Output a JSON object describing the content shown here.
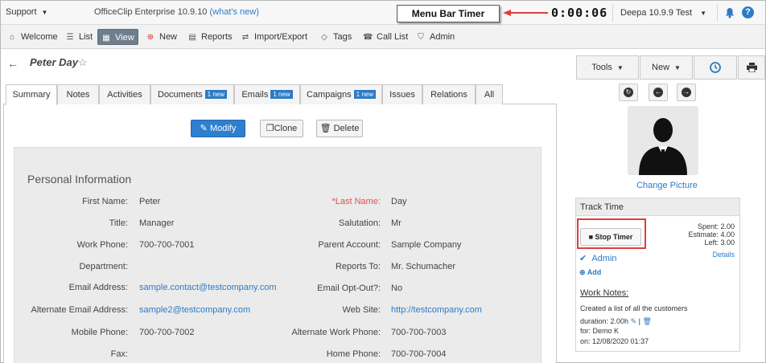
{
  "topbar": {
    "support_label": "Support",
    "product_name": "OfficeClip Enterprise 10.9.10",
    "whats_new": "(what's new)",
    "callout_label": "Menu Bar Timer",
    "timer_value": "0:00:06",
    "user_label": "Deepa 10.9.9 Test",
    "help_glyph": "?"
  },
  "nav": {
    "items": [
      {
        "label": "Welcome",
        "icon": "home-icon"
      },
      {
        "label": "List",
        "icon": "list-icon"
      },
      {
        "label": "View",
        "icon": "view-icon"
      },
      {
        "label": "New",
        "icon": "new-icon"
      },
      {
        "label": "Reports",
        "icon": "reports-icon"
      },
      {
        "label": "Import/Export",
        "icon": "import-export-icon"
      },
      {
        "label": "Tags",
        "icon": "tag-icon"
      },
      {
        "label": "Call List",
        "icon": "phone-icon"
      },
      {
        "label": "Admin",
        "icon": "shield-icon"
      }
    ],
    "active": "View"
  },
  "record": {
    "title": "Peter Day"
  },
  "toolbar": {
    "tools_label": "Tools",
    "new_label": "New"
  },
  "tabs": [
    {
      "label": "Summary",
      "badge": ""
    },
    {
      "label": "Notes",
      "badge": ""
    },
    {
      "label": "Activities",
      "badge": ""
    },
    {
      "label": "Documents",
      "badge": "1 new"
    },
    {
      "label": "Emails",
      "badge": "1 new"
    },
    {
      "label": "Campaigns",
      "badge": "1 new"
    },
    {
      "label": "Issues",
      "badge": ""
    },
    {
      "label": "Relations",
      "badge": ""
    },
    {
      "label": "All",
      "badge": ""
    }
  ],
  "actions": {
    "modify": "Modify",
    "clone": "Clone",
    "delete": "Delete"
  },
  "personal": {
    "section_title": "Personal Information",
    "left": [
      {
        "label": "First Name:",
        "value": "Peter"
      },
      {
        "label": "Title:",
        "value": "Manager"
      },
      {
        "label": "Work Phone:",
        "value": "700-700-7001"
      },
      {
        "label": "Department:",
        "value": ""
      },
      {
        "label": "Email Address:",
        "value": "sample.contact@testcompany.com"
      },
      {
        "label": "Alternate Email Address:",
        "value": "sample2@testcompany.com"
      },
      {
        "label": "Mobile Phone:",
        "value": "700-700-7002"
      },
      {
        "label": "Fax:",
        "value": ""
      }
    ],
    "right": [
      {
        "label": "*Last Name:",
        "value": "Day"
      },
      {
        "label": "Salutation:",
        "value": "Mr"
      },
      {
        "label": "Parent Account:",
        "value": "Sample Company"
      },
      {
        "label": "Reports To:",
        "value": "Mr. Schumacher"
      },
      {
        "label": "Email Opt-Out?:",
        "value": "No"
      },
      {
        "label": "Web Site:",
        "value": "http://testcompany.com"
      },
      {
        "label": "Alternate Work Phone:",
        "value": "700-700-7003"
      },
      {
        "label": "Home Phone:",
        "value": "700-700-7004"
      }
    ]
  },
  "sidepanel": {
    "change_picture": "Change Picture",
    "track_title": "Track Time",
    "stop_timer": "Stop Timer",
    "spent": "Spent: 2.00",
    "estimate": "Estimate: 4.00",
    "left": "Left: 3.00",
    "details": "Details",
    "owner": "Admin",
    "add": "Add",
    "work_notes_title": "Work Notes:",
    "note_text": "Created a list of all the customers",
    "duration": "duration: 2.00h",
    "separator": "|",
    "for": "for: Demo K",
    "on": "on: 12/08/2020 01:37"
  },
  "colors": {
    "accent": "#2c7bc4",
    "highlight_red": "#e03c3c",
    "active_nav": "#6e7e8c"
  }
}
